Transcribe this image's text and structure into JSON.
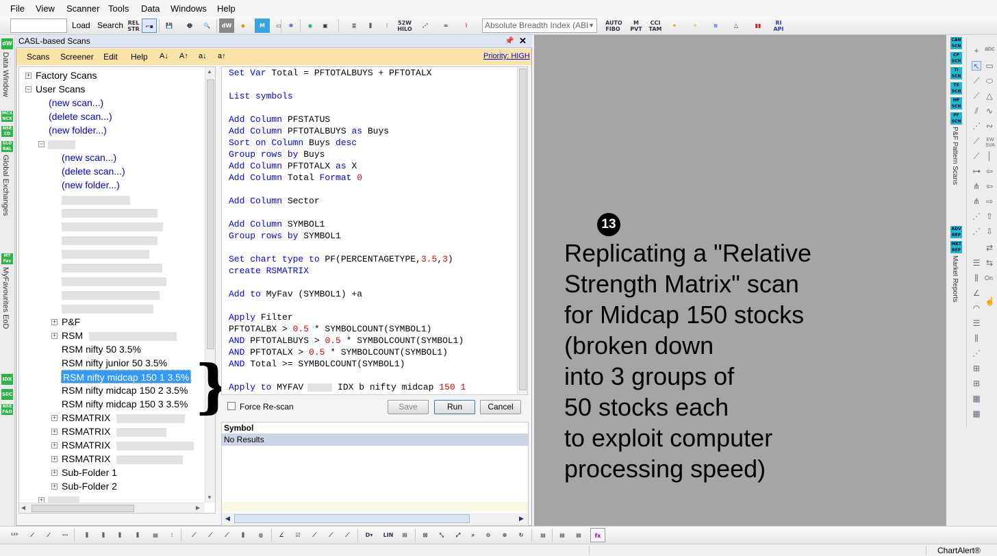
{
  "menu": [
    "File",
    "View",
    "Scanner",
    "Tools",
    "Data",
    "Windows",
    "Help"
  ],
  "toolbar": {
    "load": "Load",
    "search": "Search",
    "relstr": "REL STR",
    "dropdown_value": "Absolute Breadth Index (ABI",
    "icons": [
      "52W HILO",
      "AUTO FIBO",
      "M PVT",
      "CCI TAM",
      "RI API"
    ]
  },
  "left_strip": {
    "badges": [
      "dW",
      "MCX NCX",
      "NSE CD",
      "GLO BAL",
      "MY Fav",
      "IDX",
      "SEC",
      "NSE F&O"
    ],
    "labels": [
      "Data Window",
      "Global Exchanges",
      "MyFavourites EoD"
    ]
  },
  "panel": {
    "title": "CASL-based Scans",
    "pin": "📌",
    "close": "✕",
    "menu": [
      "Scans",
      "Screener",
      "Edit",
      "Help",
      "A↓",
      "A↑",
      "a↓",
      "a↑"
    ],
    "priority": "Priority: HIGH"
  },
  "tree": {
    "factory": "Factory Scans",
    "user": "User Scans",
    "new_scan": "(new scan...)",
    "delete_scan": "(delete scan...)",
    "new_folder": "(new folder...)",
    "pf": "P&F",
    "rsm": "RSM",
    "rsm_nifty50": "RSM nifty 50 3.5%",
    "rsm_junior": "RSM nifty junior 50 3.5%",
    "rsm_midcap1": "RSM nifty midcap 150 1 3.5%",
    "rsm_midcap2": "RSM nifty midcap 150 2 3.5%",
    "rsm_midcap3": "RSM nifty midcap 150 3 3.5%",
    "rsmatrix": "RSMATRIX",
    "sub1": "Sub-Folder 1",
    "sub2": "Sub-Folder 2"
  },
  "brace": "}",
  "editor": {
    "l1_kw": "Set Var",
    "l1_rest": " Total = PFTOTALBUYS + PFTOTALX",
    "l2_kw": "List symbols",
    "l3_kw": "Add Column",
    "l3_rest": " PFSTATUS",
    "l4_kw": "Add Column",
    "l4_a": " PFTOTALBUYS ",
    "l4_kw2": "as",
    "l4_b": " Buys",
    "l5_kw": "Sort on Column",
    "l5_a": " Buys ",
    "l5_kw2": "desc",
    "l6_kw": "Group rows by",
    "l6_a": " Buys",
    "l7_kw": "Add Column",
    "l7_a": " PFTOTALX ",
    "l7_kw2": "as",
    "l7_b": " X",
    "l8_kw": "Add Column",
    "l8_a": " Total ",
    "l8_kw2": "Format",
    "l8_num": " 0",
    "l9_kw": "Add Column",
    "l9_a": " Sector",
    "l10_kw": "Add Column",
    "l10_a": " SYMBOL1",
    "l11_kw": "Group rows by",
    "l11_a": " SYMBOL1",
    "l12_kw": "Set chart type to",
    "l12_a": " PF(PERCENTAGETYPE,",
    "l12_n1": "3.5",
    "l12_c": ",",
    "l12_n2": "3",
    "l12_e": ")",
    "l13_kw": "create RSMATRIX",
    "l14_kw": "Add to",
    "l14_a": " MyFav (SYMBOL1) +a",
    "l15_kw": "Apply",
    "l15_a": " Filter",
    "l16_a": "PFTOTALBX > ",
    "l16_n": "0.5",
    "l16_b": " * SYMBOLCOUNT(SYMBOL1)",
    "l17_kw": "AND",
    "l17_a": " PFTOTALBUYS > ",
    "l17_n": "0.5",
    "l17_b": " * SYMBOLCOUNT(SYMBOL1)",
    "l18_kw": "AND",
    "l18_a": " PFTOTALX > ",
    "l18_n": "0.5",
    "l18_b": " * SYMBOLCOUNT(SYMBOL1)",
    "l19_kw": "AND",
    "l19_a": " Total >= SYMBOLCOUNT(SYMBOL1)",
    "l20_kw": "Apply to",
    "l20_a": " MYFAV",
    "l20_b": " IDX b nifty midcap ",
    "l20_n": "150 1"
  },
  "controls": {
    "force": "Force Re-scan",
    "save": "Save",
    "run": "Run",
    "cancel": "Cancel"
  },
  "results": {
    "header": "Symbol",
    "row": "No Results"
  },
  "annotation": {
    "number": "13",
    "lines": [
      "Replicating a \"Relative",
      "Strength Matrix\" scan",
      "for Midcap 150 stocks",
      "(broken down",
      "into 3 groups of",
      "50 stocks each",
      "to exploit computer",
      "processing speed)"
    ]
  },
  "right_panel": {
    "badges": [
      "CAN SCN",
      "CP SCN",
      "TI SCN",
      "TS SCN",
      "HP SCN",
      "PF SCN",
      "ADV REP",
      "MKT REP"
    ],
    "labels": [
      "P&F Pattern Scans",
      "Market Reports"
    ],
    "tool_text": [
      "abc",
      "EW SVA",
      "On"
    ]
  },
  "status": {
    "brand": "ChartAlert®"
  },
  "colors": {
    "selected": "#3399ff",
    "menu_band": "#fae3a6",
    "badge_green": "#2db34a",
    "badge_cyan": "#22b8c8",
    "canvas": "#a5a5a5"
  }
}
